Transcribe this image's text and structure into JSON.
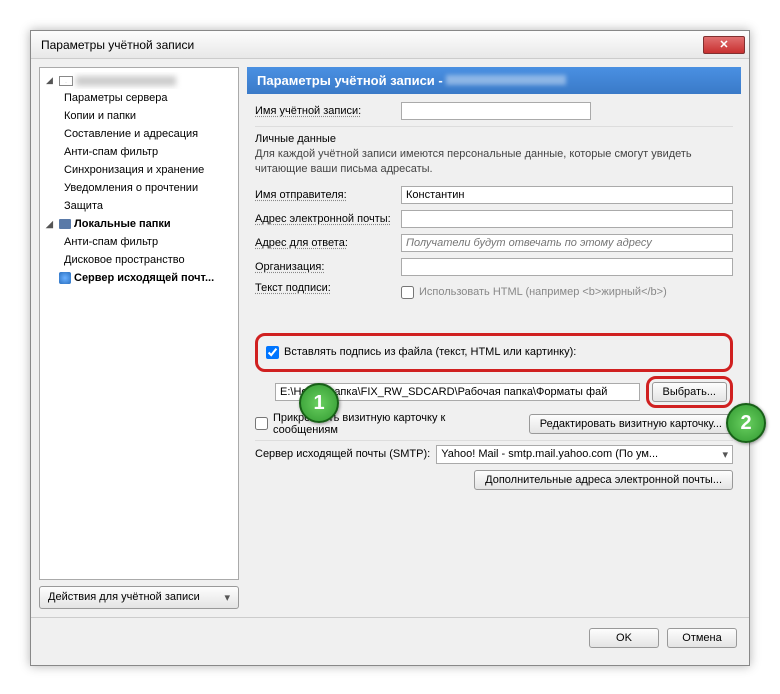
{
  "window": {
    "title": "Параметры учётной записи"
  },
  "sidebar": {
    "account_root": "",
    "items": [
      "Параметры сервера",
      "Копии и папки",
      "Составление и адресация",
      "Анти-спам фильтр",
      "Синхронизация и хранение",
      "Уведомления о прочтении",
      "Защита"
    ],
    "local_folders": "Локальные папки",
    "local_items": [
      "Анти-спам фильтр",
      "Дисковое пространство"
    ],
    "smtp_server": "Сервер исходящей почт...",
    "actions_button": "Действия для учётной записи"
  },
  "main": {
    "banner": "Параметры учётной записи - ",
    "account_name_label": "Имя учётной записи:",
    "account_name_value": "",
    "personal_data_title": "Личные данные",
    "personal_data_desc": "Для каждой учётной записи имеются персональные данные, которые смогут увидеть читающие ваши письма адресаты.",
    "sender_name_label": "Имя отправителя:",
    "sender_name_value": "Константин",
    "email_label": "Адрес электронной почты:",
    "email_value": "",
    "reply_label": "Адрес для ответа:",
    "reply_placeholder": "Получатели будут отвечать по этому адресу",
    "org_label": "Организация:",
    "org_value": "",
    "sig_label": "Текст подписи:",
    "use_html_label": "Использовать HTML (например <b>жирный</b>)",
    "insert_sig_label": "Вставлять подпись из файла (текст, HTML или картинку):",
    "file_path": "E:\\Новая папка\\FIX_RW_SDCARD\\Рабочая папка\\Форматы фай",
    "choose_button": "Выбрать...",
    "vcard_label": "Прикреплять визитную карточку к сообщениям",
    "edit_vcard_button": "Редактировать визитную карточку...",
    "smtp_label": "Сервер исходящей почты (SMTP):",
    "smtp_value": "Yahoo! Mail - smtp.mail.yahoo.com (По ум...",
    "extra_addresses_button": "Дополнительные адреса электронной почты..."
  },
  "footer": {
    "ok": "OK",
    "cancel": "Отмена"
  },
  "callouts": {
    "one": "1",
    "two": "2"
  }
}
